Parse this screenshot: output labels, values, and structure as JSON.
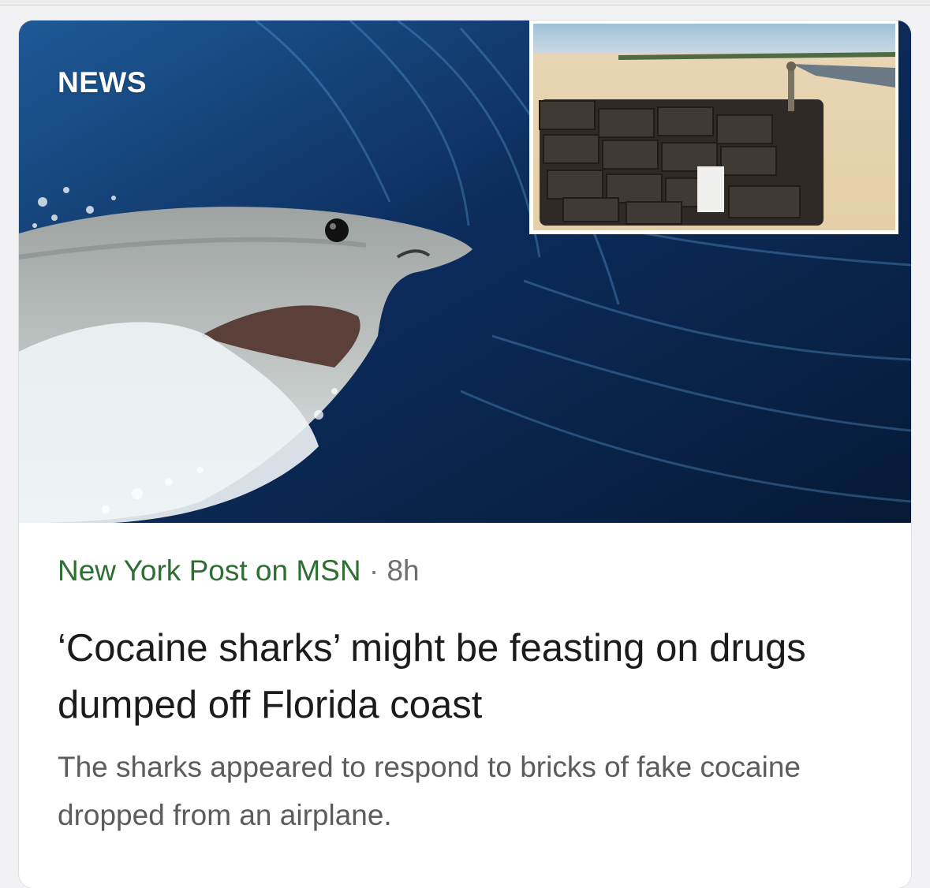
{
  "card": {
    "section_label": "NEWS",
    "source": "New York Post on MSN",
    "separator": "·",
    "age": "8h",
    "headline": "‘Cocaine sharks’ might be feasting on drugs dumped off Florida coast",
    "summary": "The sharks appeared to respond to bricks of fake cocaine dropped from an airplane.",
    "image": {
      "main": "shark-photo",
      "inset": "beach-drug-bricks-photo"
    }
  },
  "colors": {
    "source": "#2f6e33",
    "headline": "#1b1b1d",
    "summary": "#5c5c60",
    "meta": "#6e6e73"
  }
}
